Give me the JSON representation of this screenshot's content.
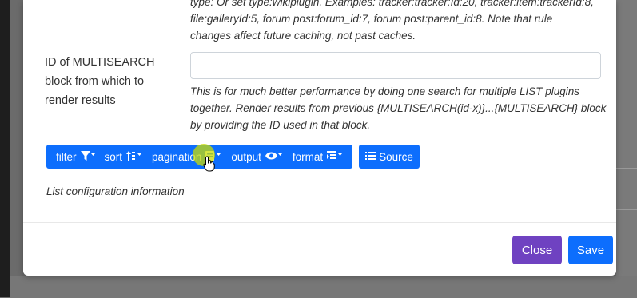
{
  "help_top": {
    "line1": "type: Or set type:wikiplugin. Examples: tracker:tracker:Id:20, tracker:item:trackerId:8,",
    "line2": "file:galleryId:5, forum post:forum_id:7, forum post:parent_id:8. Note that rule",
    "line3": "changes affect future caching, not past caches."
  },
  "multisearch": {
    "label": "ID of MULTISEARCH block from which to render results",
    "value": "",
    "help": "This is for much better performance by doing one search for multiple LIST plugins together. Render results from previous {MULTISEARCH(id-x)}...{MULTISEARCH} block by providing the ID used in that block."
  },
  "toolbar": {
    "filter": "filter",
    "sort": "sort",
    "pagination": "pagination",
    "output": "output",
    "format": "format",
    "source": "Source"
  },
  "list_info": "List configuration information",
  "footer": {
    "close": "Close",
    "save": "Save"
  },
  "colors": {
    "primary": "#0d6efd",
    "close": "#6f42c1"
  }
}
